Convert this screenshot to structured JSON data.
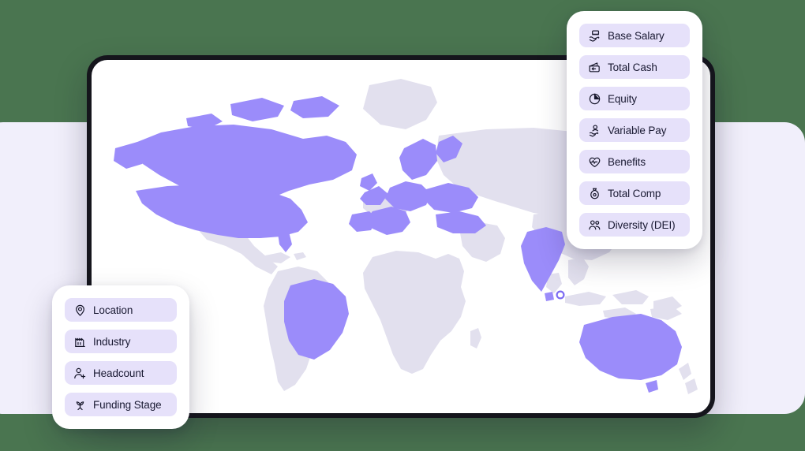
{
  "theme": {
    "page_background": "#4a7550",
    "back_panel_color": "#f1effb",
    "map_card_bezel": "#15151c",
    "map_surface": "#ffffff",
    "land_inactive": "#e2e0ee",
    "land_highlight": "#9b8cfa",
    "pill_background": "#e6e1fa",
    "pill_text": "#191932"
  },
  "map": {
    "name": "world-map",
    "highlighted_regions": [
      "United States",
      "Canada",
      "Brazil",
      "United Kingdom",
      "Ireland",
      "France",
      "Spain",
      "Portugal",
      "Germany",
      "Poland",
      "Italy",
      "Netherlands",
      "Belgium",
      "Switzerland",
      "Austria",
      "Czechia",
      "Sweden",
      "Norway",
      "Finland",
      "Denmark",
      "Romania",
      "Ukraine",
      "Turkey",
      "Greece",
      "India",
      "Australia"
    ],
    "marker_label": "Singapore"
  },
  "compensation_panel": {
    "name": "compensation-metrics-panel",
    "items": [
      {
        "label": "Base Salary",
        "icon": "salary-hand-icon"
      },
      {
        "label": "Total Cash",
        "icon": "cash-wallet-icon"
      },
      {
        "label": "Equity",
        "icon": "pie-chart-icon"
      },
      {
        "label": "Variable Pay",
        "icon": "person-hand-icon"
      },
      {
        "label": "Benefits",
        "icon": "heart-pulse-icon"
      },
      {
        "label": "Total Comp",
        "icon": "money-bag-icon"
      },
      {
        "label": "Diversity (DEI)",
        "icon": "users-icon"
      }
    ]
  },
  "filters_panel": {
    "name": "company-filters-panel",
    "items": [
      {
        "label": "Location",
        "icon": "map-pin-icon"
      },
      {
        "label": "Industry",
        "icon": "factory-icon"
      },
      {
        "label": "Headcount",
        "icon": "user-plus-icon"
      },
      {
        "label": "Funding Stage",
        "icon": "sprout-icon"
      }
    ]
  }
}
